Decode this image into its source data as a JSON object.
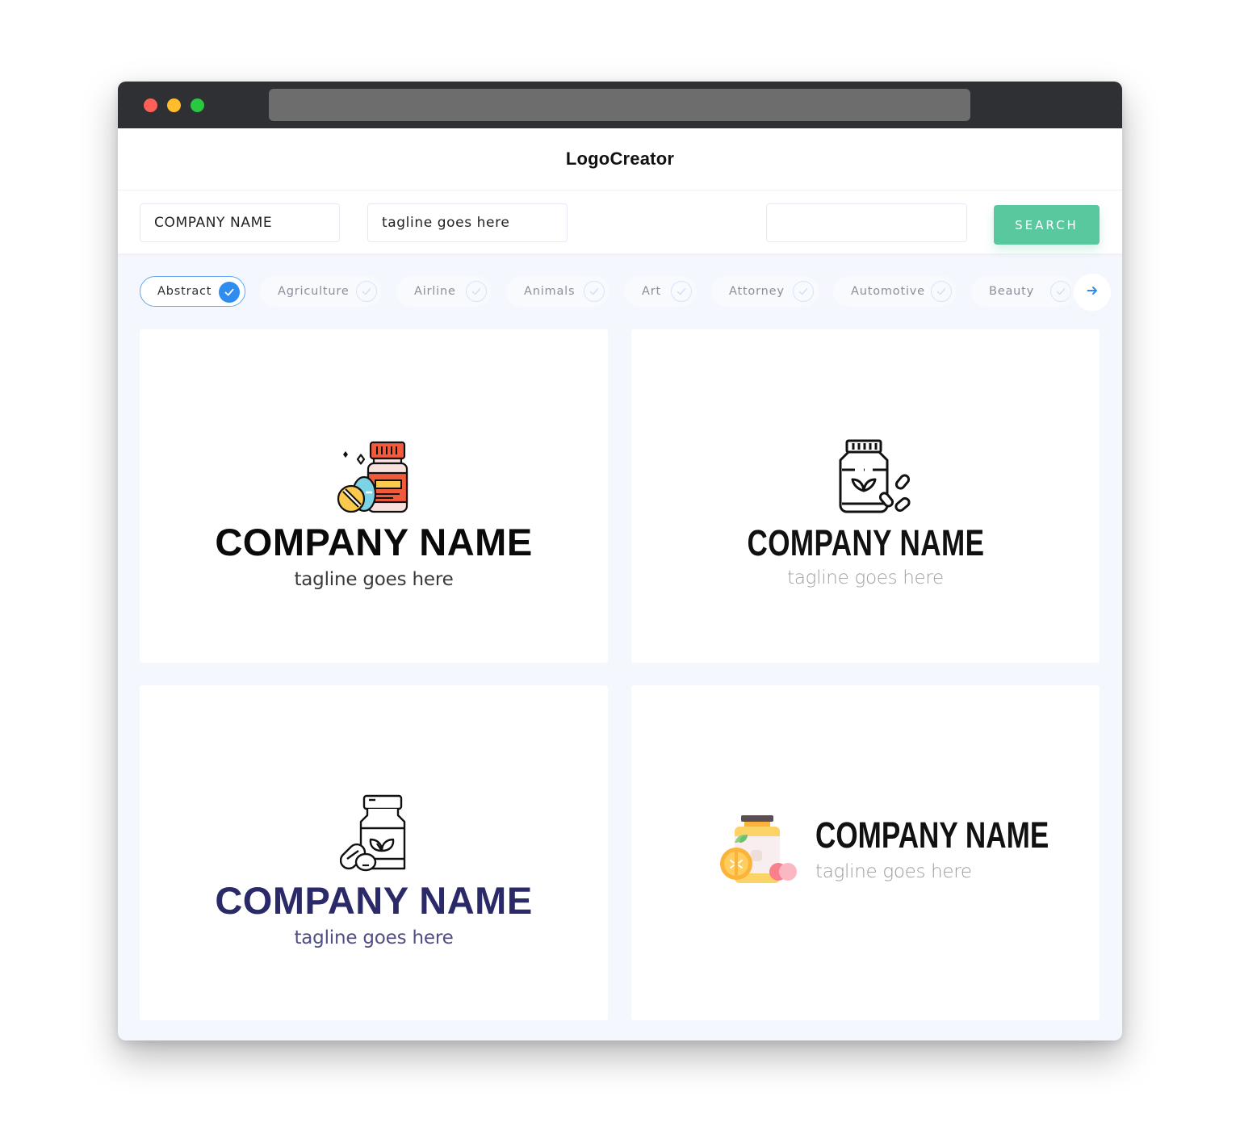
{
  "window": {
    "controls": [
      "close",
      "minimize",
      "maximize"
    ],
    "url": ""
  },
  "app": {
    "title": "LogoCreator"
  },
  "toolbar": {
    "company_name_value": "COMPANY NAME",
    "tagline_value": "tagline goes here",
    "extra_value": "",
    "search_label": "SEARCH"
  },
  "categories": {
    "items": [
      {
        "label": "Abstract",
        "selected": true
      },
      {
        "label": "Agriculture",
        "selected": false
      },
      {
        "label": "Airline",
        "selected": false
      },
      {
        "label": "Animals",
        "selected": false
      },
      {
        "label": "Art",
        "selected": false
      },
      {
        "label": "Attorney",
        "selected": false
      },
      {
        "label": "Automotive",
        "selected": false
      },
      {
        "label": "Beauty",
        "selected": false
      }
    ],
    "next_icon": "arrow-right-icon"
  },
  "logos": [
    {
      "company": "COMPANY NAME",
      "tagline": "tagline goes here",
      "icon": "colored-medicine-bottle-pills-icon",
      "text_color": "#0a0a0a",
      "layout": "stacked"
    },
    {
      "company": "COMPANY NAME",
      "tagline": "tagline goes here",
      "icon": "outline-supplement-jar-leaf-icon",
      "text_color": "#111111",
      "layout": "stacked"
    },
    {
      "company": "COMPANY NAME",
      "tagline": "tagline goes here",
      "icon": "outline-herbal-bottle-capsule-icon",
      "text_color": "#2b2a69",
      "layout": "stacked"
    },
    {
      "company": "COMPANY NAME",
      "tagline": "tagline goes here",
      "icon": "flat-vitamin-jar-orange-icon",
      "text_color": "#111111",
      "layout": "inline"
    }
  ],
  "colors": {
    "accent_green": "#59c89f",
    "accent_blue": "#2f8cf0",
    "background": "#f4f7fd",
    "titlebar": "#2f3033"
  }
}
